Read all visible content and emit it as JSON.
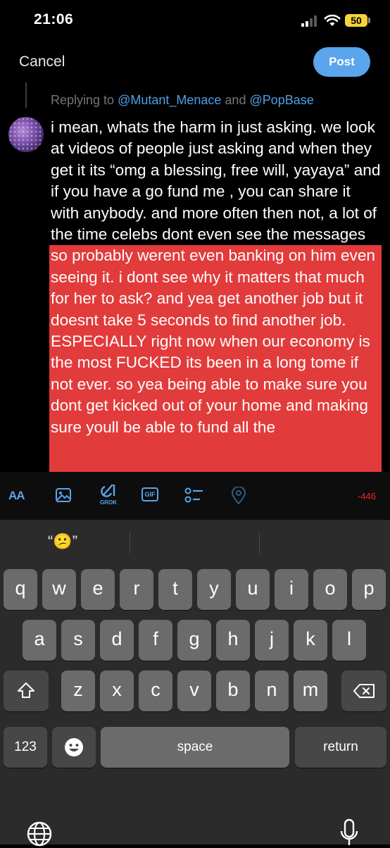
{
  "status_bar": {
    "time": "21:06",
    "battery": "50"
  },
  "header": {
    "cancel_label": "Cancel",
    "post_label": "Post"
  },
  "reply": {
    "prefix": "Replying to ",
    "mention_1": "@Mutant_Menace",
    "joiner": " and ",
    "mention_2": "@PopBase"
  },
  "tweet": {
    "text": "i mean, whats the harm in just asking. we look at videos of people just asking and when they get it its “omg a blessing, free will, yayaya” and if you have a go fund me , you can share it with anybody. and more often then not, a lot of the time celebs dont even see the messages so probably werent even banking on him even seeing it. i dont see why it matters that much for her to ask? and yea get another job but it doesnt take 5 seconds to find another job. ESPECIALLY right now when our economy is the most FUCKED its been in a long tome if not ever. so yea being able to make sure you dont get kicked out of your home and making sure youll be able to fund all the",
    "highlight_color": "#e23b3b"
  },
  "toolbar": {
    "format_label": "AA",
    "grok_label": "GROK",
    "gif_label": "GIF",
    "char_count": "-446",
    "accent_color": "#5aa5eb",
    "icons": [
      "text-format-icon",
      "image-icon",
      "grok-icon",
      "gif-icon",
      "poll-icon",
      "location-icon"
    ]
  },
  "keyboard": {
    "suggestion": "“😕”",
    "row1": [
      "q",
      "w",
      "e",
      "r",
      "t",
      "y",
      "u",
      "i",
      "o",
      "p"
    ],
    "row2": [
      "a",
      "s",
      "d",
      "f",
      "g",
      "h",
      "j",
      "k",
      "l"
    ],
    "row3": [
      "z",
      "x",
      "c",
      "v",
      "b",
      "n",
      "m"
    ],
    "numbers_label": "123",
    "space_label": "space",
    "return_label": "return",
    "icons": [
      "shift-icon",
      "backspace-icon",
      "emoji-icon",
      "globe-icon",
      "mic-icon"
    ]
  }
}
